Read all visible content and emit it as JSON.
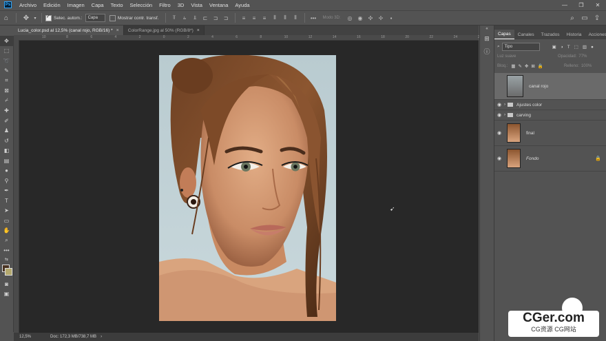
{
  "menu": [
    "Archivo",
    "Edición",
    "Imagen",
    "Capa",
    "Texto",
    "Selección",
    "Filtro",
    "3D",
    "Vista",
    "Ventana",
    "Ayuda"
  ],
  "app_icon": "Ps",
  "options": {
    "auto_select_label": "Selec. autom.:",
    "auto_select_value": "Capa",
    "transform_label": "Mostrar contr. transf.",
    "mode_3d": "Modo 3D:"
  },
  "tabs": [
    {
      "label": "Lucia_color.psd al 12,5% (canal rojo, RGB/16) *",
      "close": "×"
    },
    {
      "label": "ColorRange.jpg al 50% (RGB/8*)",
      "close": "×"
    }
  ],
  "ruler": [
    "10",
    "8",
    "6",
    "4",
    "2",
    "0",
    "2",
    "4",
    "6",
    "8",
    "10",
    "12",
    "14",
    "16",
    "18",
    "20",
    "22",
    "24",
    "26"
  ],
  "status": {
    "zoom": "12,5%",
    "doc": "Doc: 172,3 MB/738,7 MB"
  },
  "panel": {
    "tabs": [
      "Capas",
      "Canales",
      "Trazados",
      "Historia",
      "Acciones"
    ],
    "filter_label": "Tipo",
    "blend_mode": "Luz suave",
    "opacity_label": "Opacidad:",
    "opacity_value": "77%",
    "lock_label": "Bloq.:",
    "fill_label": "Relleno:",
    "fill_value": "100%",
    "layers": [
      {
        "name": "canal rojo"
      },
      {
        "name": "Ajustes color"
      },
      {
        "name": "carving"
      },
      {
        "name": "final"
      },
      {
        "name": "Fondo"
      }
    ]
  },
  "watermark": {
    "top": "CGer.com",
    "bottom": "CG资源 CG网站"
  },
  "colors": {
    "foreground": "#4a3322",
    "background": "#b4a96e",
    "canvas": "#282828"
  }
}
